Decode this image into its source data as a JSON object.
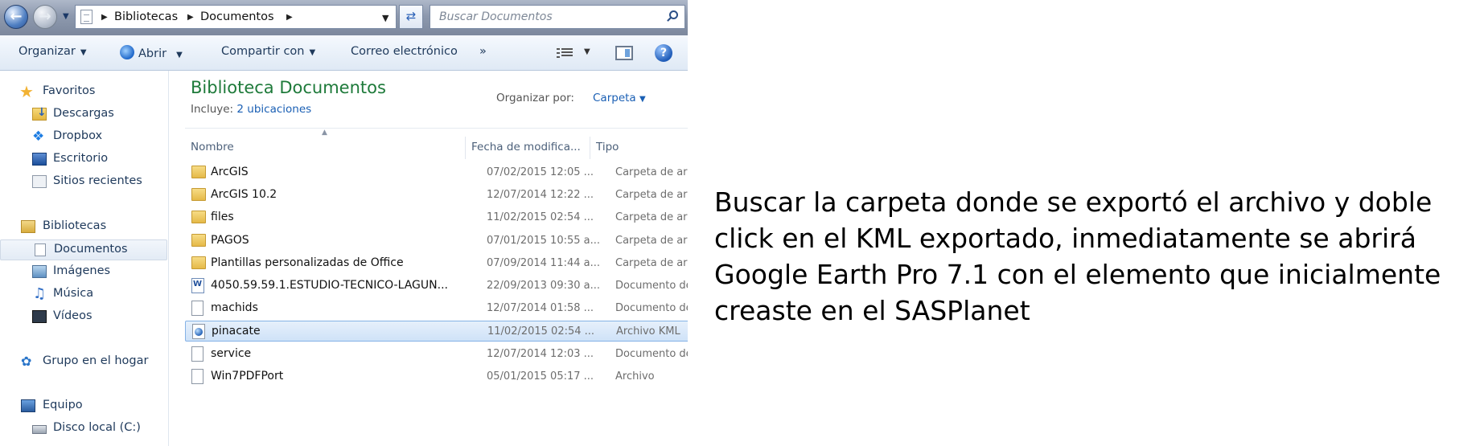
{
  "address_bar": {
    "crumbs": [
      "Bibliotecas",
      "Documentos"
    ],
    "search_placeholder": "Buscar Documentos"
  },
  "toolbar": {
    "organize": "Organizar",
    "open": "Abrir",
    "share": "Compartir con",
    "email": "Correo electrónico",
    "more": "»"
  },
  "nav_pane": {
    "favorites": "Favoritos",
    "downloads": "Descargas",
    "dropbox": "Dropbox",
    "desktop": "Escritorio",
    "recent": "Sitios recientes",
    "libraries": "Bibliotecas",
    "documents": "Documentos",
    "images": "Imágenes",
    "music": "Música",
    "videos": "Vídeos",
    "homegroup": "Grupo en el hogar",
    "computer": "Equipo",
    "local_disk": "Disco local (C:)"
  },
  "content": {
    "title": "Biblioteca Documentos",
    "includes_label": "Incluye:",
    "includes_link": "2 ubicaciones",
    "arrange_label": "Organizar por:",
    "arrange_value": "Carpeta",
    "columns": {
      "name": "Nombre",
      "date": "Fecha de modifica...",
      "type": "Tipo"
    },
    "files": [
      {
        "name": "ArcGIS",
        "date": "07/02/2015 12:05 ...",
        "type": "Carpeta de archi",
        "icon": "folder-icon"
      },
      {
        "name": "ArcGIS 10.2",
        "date": "12/07/2014 12:22 ...",
        "type": "Carpeta de archi",
        "icon": "folder-icon"
      },
      {
        "name": "files",
        "date": "11/02/2015 02:54 ...",
        "type": "Carpeta de archi",
        "icon": "folder-icon"
      },
      {
        "name": "PAGOS",
        "date": "07/01/2015 10:55 a...",
        "type": "Carpeta de archi",
        "icon": "folder-icon"
      },
      {
        "name": "Plantillas personalizadas de Office",
        "date": "07/09/2014 11:44 a...",
        "type": "Carpeta de archi",
        "icon": "folder-icon"
      },
      {
        "name": "4050.59.59.1.ESTUDIO-TECNICO-LAGUN...",
        "date": "22/09/2013 09:30 a...",
        "type": "Documento de M",
        "icon": "word-document-icon"
      },
      {
        "name": "machids",
        "date": "12/07/2014 01:58 ...",
        "type": "Documento de t",
        "icon": "text-file-icon"
      },
      {
        "name": "pinacate",
        "date": "11/02/2015 02:54 ...",
        "type": "Archivo KML",
        "icon": "kml-file-icon",
        "selected": true
      },
      {
        "name": "service",
        "date": "12/07/2014 12:03 ...",
        "type": "Documento de t",
        "icon": "text-file-icon"
      },
      {
        "name": "Win7PDFPort",
        "date": "05/01/2015 05:17 ...",
        "type": "Archivo",
        "icon": "file-icon"
      }
    ]
  },
  "caption": "Buscar la carpeta donde se exportó el archivo y doble click en el KML exportado, inmediatamente se abrirá Google Earth Pro 7.1 con el elemento que inicialmente creaste en el SASPlanet"
}
